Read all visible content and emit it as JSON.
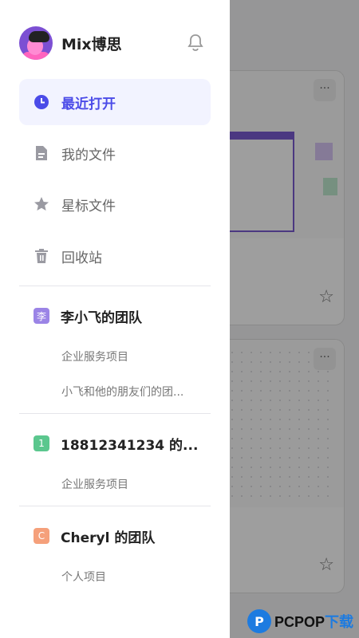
{
  "profile": {
    "name": "Mix博思"
  },
  "nav": {
    "recent": "最近打开",
    "my_files": "我的文件",
    "starred": "星标文件",
    "trash": "回收站"
  },
  "teams": [
    {
      "badge": "李",
      "badge_color": "#9b84e6",
      "name": "李小飞的团队",
      "projects": [
        "企业服务项目",
        "小飞和他的朋友们的团..."
      ]
    },
    {
      "badge": "1",
      "badge_color": "#5bc78e",
      "name": "18812341234 的...",
      "projects": [
        "企业服务项目"
      ]
    },
    {
      "badge": "C",
      "badge_color": "#f5a07b",
      "name": "Cheryl 的团队",
      "projects": [
        "个人项目"
      ]
    }
  ],
  "cards": {
    "more": "···"
  },
  "watermark": {
    "logo": "P",
    "brand": "PCPOP",
    "suffix": "下载"
  },
  "colors": {
    "accent": "#4b4be8",
    "active_bg": "#f2f3ff"
  }
}
